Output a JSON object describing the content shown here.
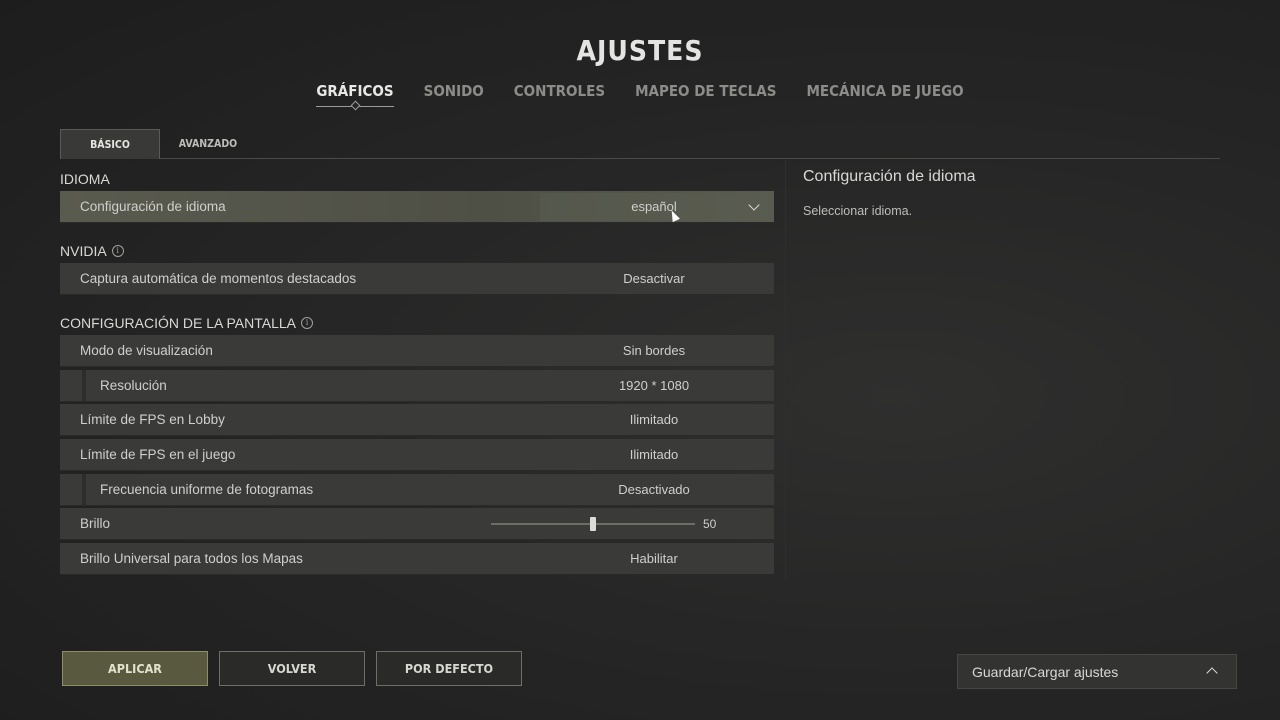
{
  "title": "AJUSTES",
  "tabs": [
    "GRÁFICOS",
    "SONIDO",
    "CONTROLES",
    "MAPEO DE TECLAS",
    "MECÁNICA DE JUEGO"
  ],
  "subtabs": {
    "basic": "BÁSICO",
    "advanced": "AVANZADO"
  },
  "sections": {
    "idioma": "IDIOMA",
    "nvidia": "NVIDIA",
    "pantalla": "CONFIGURACIÓN DE LA PANTALLA"
  },
  "rows": {
    "language": {
      "label": "Configuración de idioma",
      "value": "español"
    },
    "highlights": {
      "label": "Captura automática de momentos destacados",
      "value": "Desactivar"
    },
    "display_mode": {
      "label": "Modo de visualización",
      "value": "Sin bordes"
    },
    "resolution": {
      "label": "Resolución",
      "value": "1920 * 1080"
    },
    "fps_lobby": {
      "label": "Límite de FPS en Lobby",
      "value": "Ilimitado"
    },
    "fps_game": {
      "label": "Límite de FPS en el juego",
      "value": "Ilimitado"
    },
    "frame_pacing": {
      "label": "Frecuencia uniforme de fotogramas",
      "value": "Desactivado"
    },
    "brightness": {
      "label": "Brillo",
      "value": "50",
      "level": 50
    },
    "universal_brightness": {
      "label": "Brillo Universal para todos los Mapas",
      "value": "Habilitar"
    }
  },
  "help": {
    "title": "Configuración de idioma",
    "description": "Seleccionar idioma."
  },
  "buttons": {
    "apply": "APLICAR",
    "back": "VOLVER",
    "default": "POR DEFECTO"
  },
  "saveload": {
    "label": "Guardar/Cargar ajustes"
  },
  "icons": [
    "info-icon",
    "chevron-down-icon",
    "chevron-up-icon",
    "cursor-icon"
  ]
}
